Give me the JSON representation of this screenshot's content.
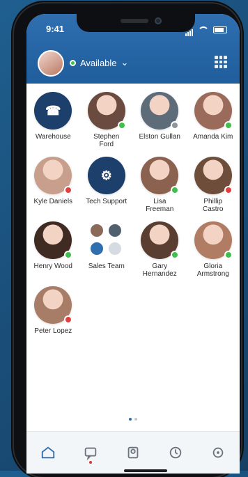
{
  "status_bar": {
    "time": "9:41"
  },
  "presence": {
    "label": "Available"
  },
  "contacts": [
    {
      "name": "Warehouse",
      "type": "shared",
      "status": "none",
      "color": "#1d3f6b",
      "glyph": "☎"
    },
    {
      "name": "Stephen\nFord",
      "type": "person",
      "status": "online",
      "color": "#6b4b3f"
    },
    {
      "name": "Elston Gullan",
      "type": "person",
      "status": "offline",
      "color": "#5e6b79"
    },
    {
      "name": "Amanda Kim",
      "type": "person",
      "status": "online",
      "color": "#9a6b5b"
    },
    {
      "name": "Kyle Daniels",
      "type": "person",
      "status": "busy",
      "color": "#c79f8c"
    },
    {
      "name": "Tech Support",
      "type": "shared",
      "status": "none",
      "color": "#1d3f6b",
      "glyph": "⚙"
    },
    {
      "name": "Lisa\nFreeman",
      "type": "person",
      "status": "online",
      "color": "#8b6150"
    },
    {
      "name": "Phillip\nCastro",
      "type": "person",
      "status": "busy",
      "color": "#6f4d3b"
    },
    {
      "name": "Henry Wood",
      "type": "person",
      "status": "online",
      "color": "#3f2b22"
    },
    {
      "name": "Sales Team",
      "type": "team",
      "status": "none",
      "color": "#e6e9ed"
    },
    {
      "name": "Gary\nHernandez",
      "type": "person",
      "status": "online",
      "color": "#5a3e31"
    },
    {
      "name": "Gloria\nArmstrong",
      "type": "person",
      "status": "online",
      "color": "#b07c63"
    },
    {
      "name": "Peter Lopez",
      "type": "person",
      "status": "busy",
      "color": "#a77d68"
    }
  ],
  "colors": {
    "online": "#3fbf4b",
    "busy": "#e33e3e",
    "offline": "#8f959c",
    "accent": "#2e6cb0"
  },
  "nav": [
    {
      "icon": "home-icon",
      "active": true
    },
    {
      "icon": "chat-icon",
      "badge": true
    },
    {
      "icon": "contacts-icon"
    },
    {
      "icon": "history-icon"
    },
    {
      "icon": "settings-icon"
    }
  ]
}
